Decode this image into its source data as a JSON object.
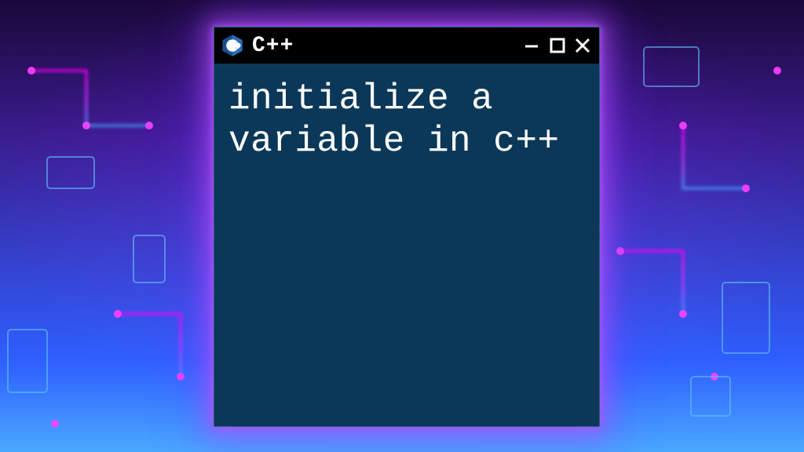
{
  "window": {
    "title": "C++",
    "logo_name": "cpp-logo",
    "content": "initialize a variable in c++",
    "controls": {
      "minimize": "minimize",
      "maximize": "maximize",
      "close": "close"
    }
  },
  "colors": {
    "window_bg": "#0b3858",
    "titlebar_bg": "#000000",
    "text": "#ffffff",
    "glow": "#c850ff"
  }
}
